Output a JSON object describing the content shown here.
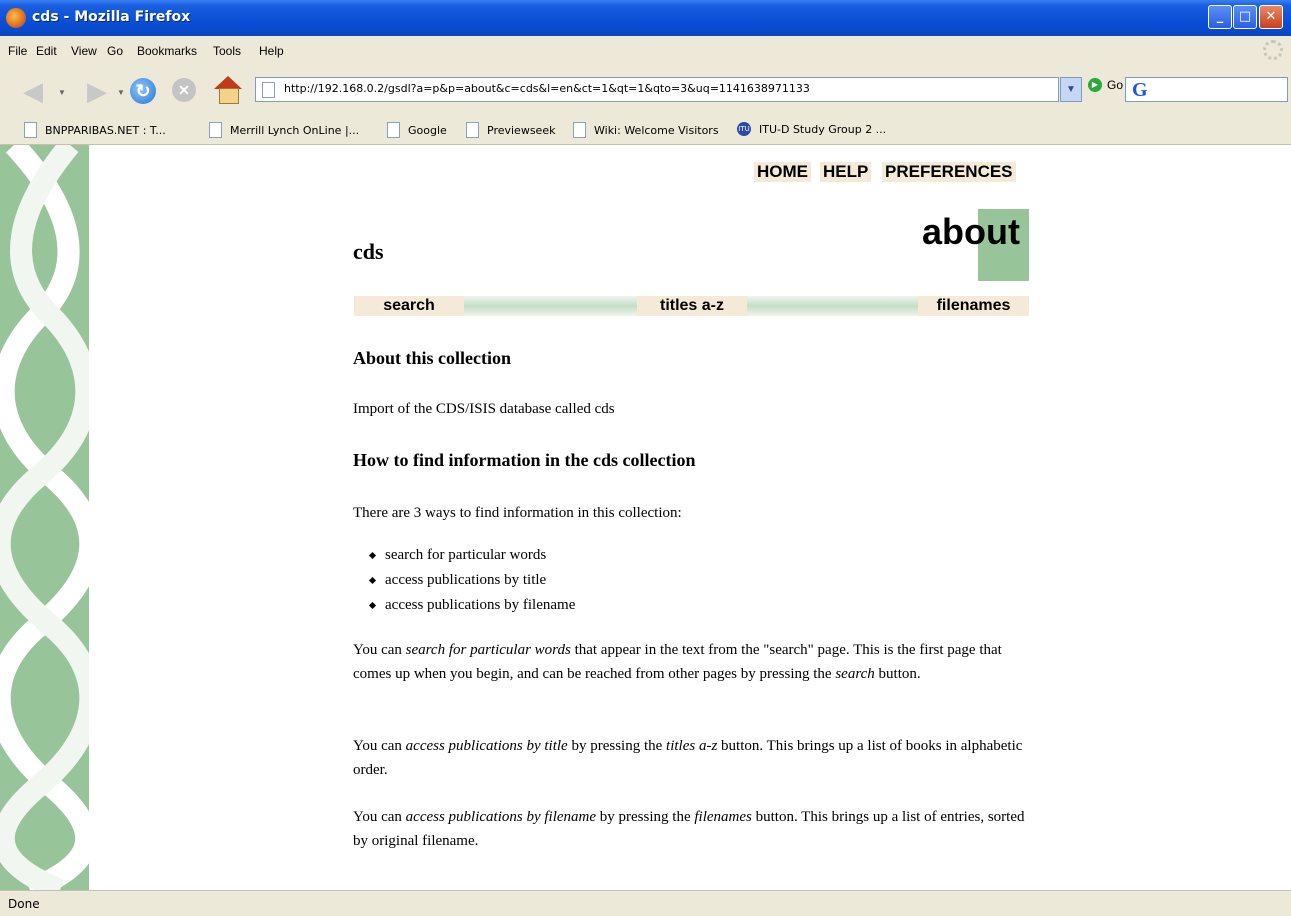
{
  "window": {
    "title": "cds - Mozilla Firefox"
  },
  "menu": [
    "File",
    "Edit",
    "View",
    "Go",
    "Bookmarks",
    "Tools",
    "Help"
  ],
  "toolbar": {
    "url": "http://192.168.0.2/gsdl?a=p&p=about&c=cds&l=en&ct=1&qt=1&qto=3&uq=1141638971133",
    "go_label": "Go",
    "search_engine_glyph": "G"
  },
  "bookmarks": [
    "BNPPARIBAS.NET : T...",
    "Merrill Lynch OnLine |...",
    "Google",
    "Previewseek",
    "Wiki: Welcome Visitors",
    "ITU-D Study Group 2 ..."
  ],
  "page": {
    "top_nav": [
      "HOME",
      "HELP",
      "PREFERENCES"
    ],
    "collection_name": "cds",
    "page_heading": "about",
    "nav": [
      "search",
      "titles a-z",
      "filenames"
    ],
    "about_heading": "About this collection",
    "about_text": "Import of the CDS/ISIS database called cds",
    "how_heading": "How to find information in the cds collection",
    "ways_intro": "There are 3 ways to find information in this collection:",
    "ways": [
      "search for particular words",
      "access publications by title",
      "access publications by filename"
    ],
    "para1": {
      "a": "You can ",
      "em1": "search for particular words",
      "b": " that appear in the text from the \"search\" page. This is the first page that comes up when you begin, and can be reached from other pages by pressing the ",
      "em2": "search",
      "c": " button."
    },
    "para2": {
      "a": "You can ",
      "em1": "access publications by title",
      "b": " by pressing the ",
      "em2": "titles a-z",
      "c": " button. This brings up a list of books in alphabetic order."
    },
    "para3": {
      "a": "You can ",
      "em1": "access publications by filename",
      "b": " by pressing the ",
      "em2": "filenames",
      "c": " button. This brings up a list of entries, sorted by original filename."
    }
  },
  "status": {
    "text": "Done"
  },
  "colors": {
    "accent_green": "#98c49a",
    "nav_tan": "#f5ead8",
    "titlebar_blue": "#0a4fd6"
  }
}
